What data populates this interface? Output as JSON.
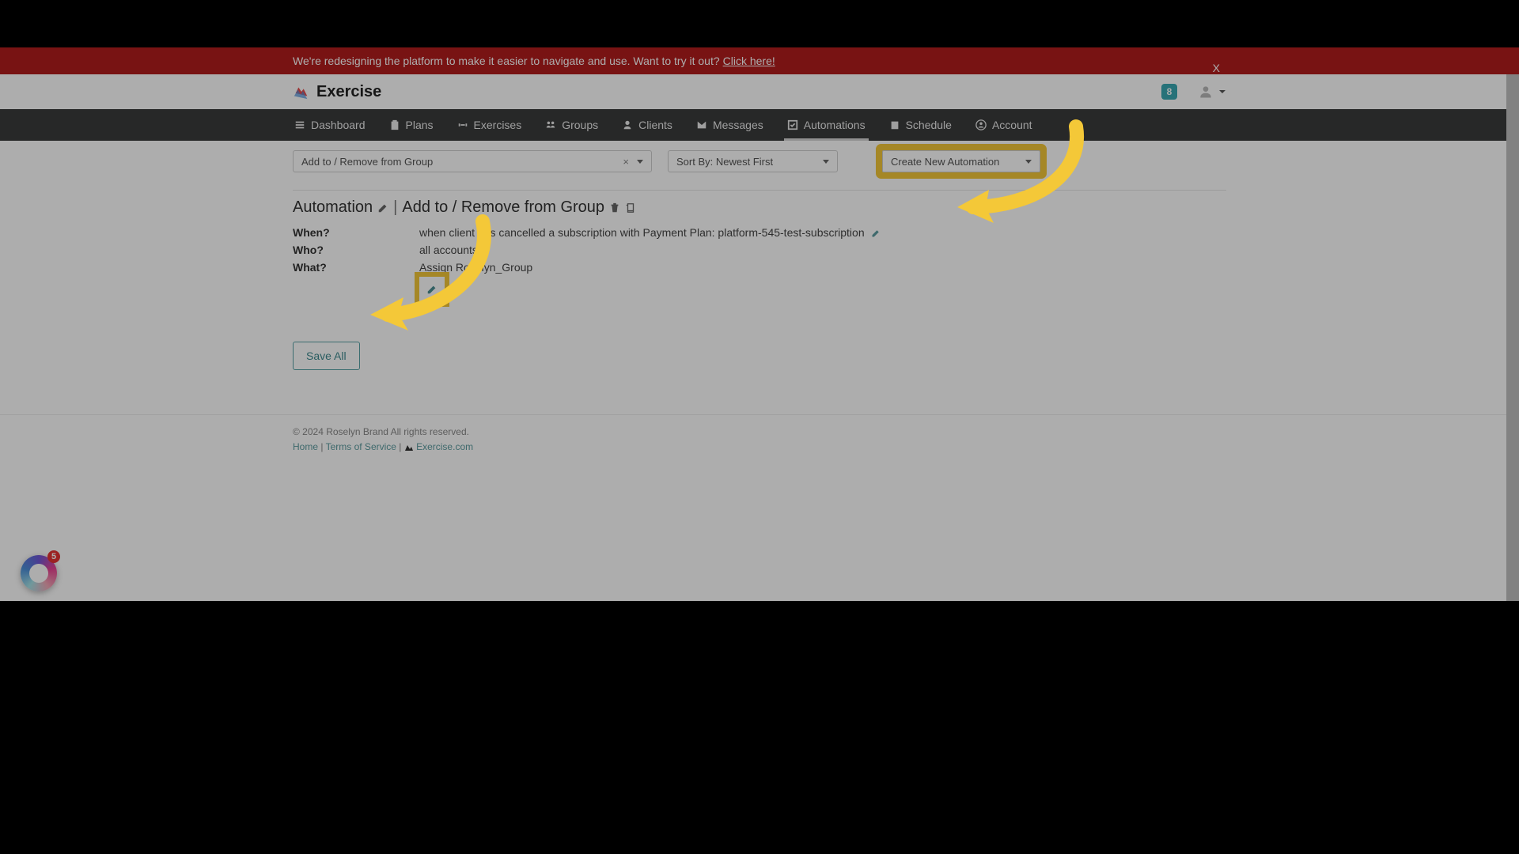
{
  "banner": {
    "text": "We're redesigning the platform to make it easier to navigate and use. Want to try it out?",
    "link_label": "Click here!",
    "close_label": "X"
  },
  "brand": {
    "name": "Exercise"
  },
  "notifications": {
    "count": "8"
  },
  "nav": {
    "items": [
      {
        "label": "Dashboard"
      },
      {
        "label": "Plans"
      },
      {
        "label": "Exercises"
      },
      {
        "label": "Groups"
      },
      {
        "label": "Clients"
      },
      {
        "label": "Messages"
      },
      {
        "label": "Automations"
      },
      {
        "label": "Schedule"
      },
      {
        "label": "Account"
      }
    ]
  },
  "controls": {
    "filter_value": "Add to / Remove from Group",
    "filter_clear": "×",
    "sort_value": "Sort By: Newest First",
    "create_value": "Create New Automation"
  },
  "automation": {
    "title_prefix": "Automation",
    "title_suffix": "Add to / Remove from Group",
    "when_label": "When?",
    "who_label": "Who?",
    "what_label": "What?",
    "when_value": "when client has cancelled a subscription with Payment Plan: platform-545-test-subscription",
    "who_value": "all accounts",
    "what_value": "Assign Roselyn_Group"
  },
  "buttons": {
    "save_all": "Save All"
  },
  "footer": {
    "copyright": "© 2024 Roselyn Brand All rights reserved.",
    "home": "Home",
    "terms": "Terms of Service",
    "exercise": "Exercise.com"
  },
  "float_widget": {
    "badge": "5"
  },
  "colors": {
    "highlight": "#f4c838",
    "banner": "#b11c1c",
    "accent": "#4b8e92"
  }
}
